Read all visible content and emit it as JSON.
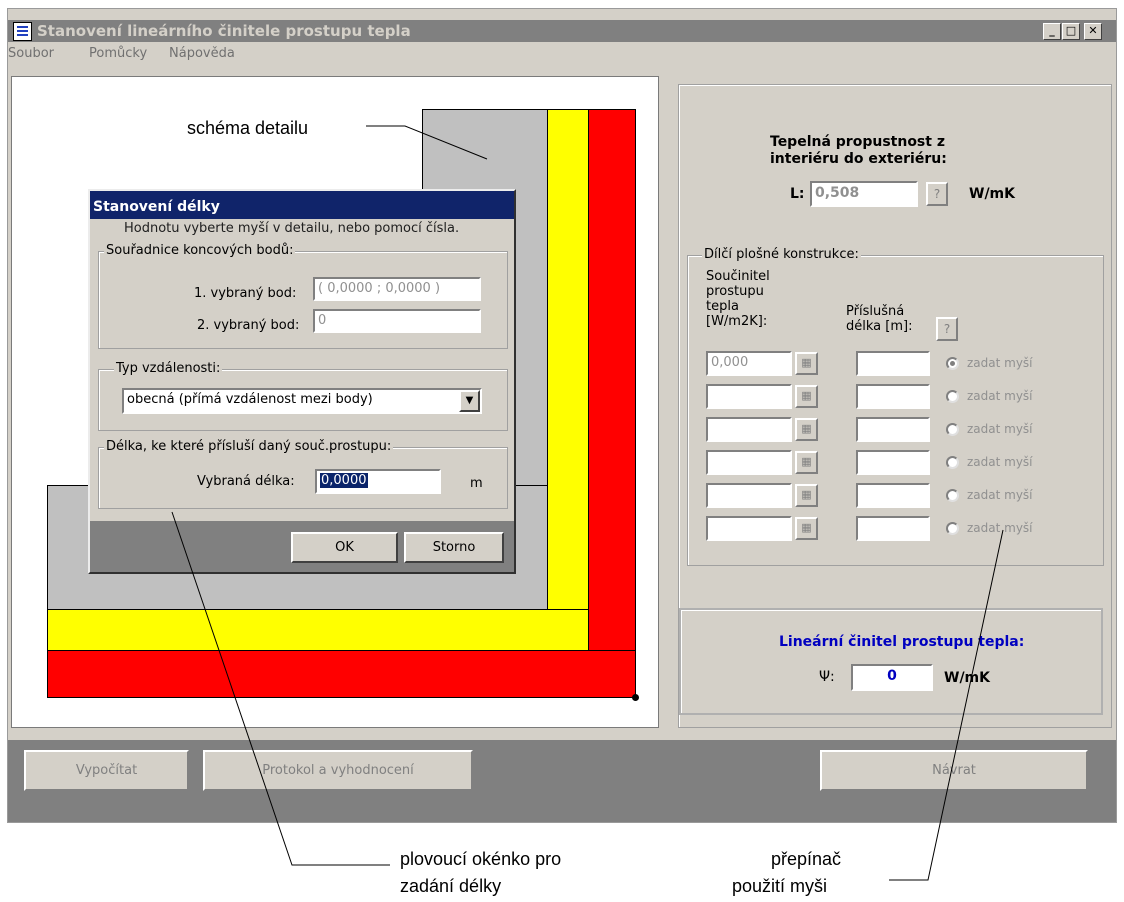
{
  "window": {
    "title": "Stanovení lineárního činitele prostupu tepla"
  },
  "menu": [
    "Soubor",
    "Pomůcky",
    "Nápověda"
  ],
  "dialog": {
    "title": "Stanovení délky",
    "hint": "Hodnotu vyberte myší v detailu, nebo pomocí čísla.",
    "coords_group": "Souřadnice koncových bodů:",
    "point1_label": "1. vybraný bod:",
    "point1_value": "( 0,0000 ; 0,0000 )",
    "point2_label": "2. vybraný bod:",
    "point2_value": "0",
    "type_group": "Typ vzdálenosti:",
    "type_value": "obecná (přímá vzdálenost mezi body)",
    "length_group": "Délka, ke které přísluší daný souč.prostupu:",
    "length_label": "Vybraná délka:",
    "length_value": "0,0000",
    "length_unit": "m",
    "ok": "OK",
    "cancel": "Storno"
  },
  "right": {
    "heading_line1": "Tepelná propustnost z",
    "heading_line2": "interiéru do exteriéru:",
    "L_label": "L:",
    "L_value": "0,508",
    "L_unit": "W/mK",
    "help": "?",
    "partial_group": "Dílčí plošné konstrukce:",
    "u_header": [
      "Součinitel",
      "prostupu",
      "tepla",
      "[W/m2K]:"
    ],
    "len_header": [
      "Příslušná",
      "délka [m]:"
    ],
    "rows": [
      {
        "u": "0,000",
        "len": "",
        "radio": "zadat myší",
        "checked": true
      },
      {
        "u": "",
        "len": "",
        "radio": "zadat myší",
        "checked": false
      },
      {
        "u": "",
        "len": "",
        "radio": "zadat myší",
        "checked": false
      },
      {
        "u": "",
        "len": "",
        "radio": "zadat myší",
        "checked": false
      },
      {
        "u": "",
        "len": "",
        "radio": "zadat myší",
        "checked": false
      },
      {
        "u": "",
        "len": "",
        "radio": "zadat myší",
        "checked": false
      }
    ],
    "psi_title": "Lineární činitel prostupu tepla:",
    "psi_label": "Ψ:",
    "psi_value": "0",
    "psi_unit": "W/mK"
  },
  "bottom": {
    "calc": "Vypočítat",
    "report": "Protokol a vyhodnocení",
    "back": "Návrat"
  },
  "annotations": {
    "scheme": "schéma detailu",
    "float1": "plovoucí okénko pro",
    "float2": "zadání délky",
    "switch1": "přepínač",
    "switch2": "použití myši"
  },
  "colors": {
    "layer_red": "#ff0000",
    "layer_yellow": "#ffff00",
    "wall_gray": "#c0c0c0",
    "accent_blue": "#0000c0"
  }
}
